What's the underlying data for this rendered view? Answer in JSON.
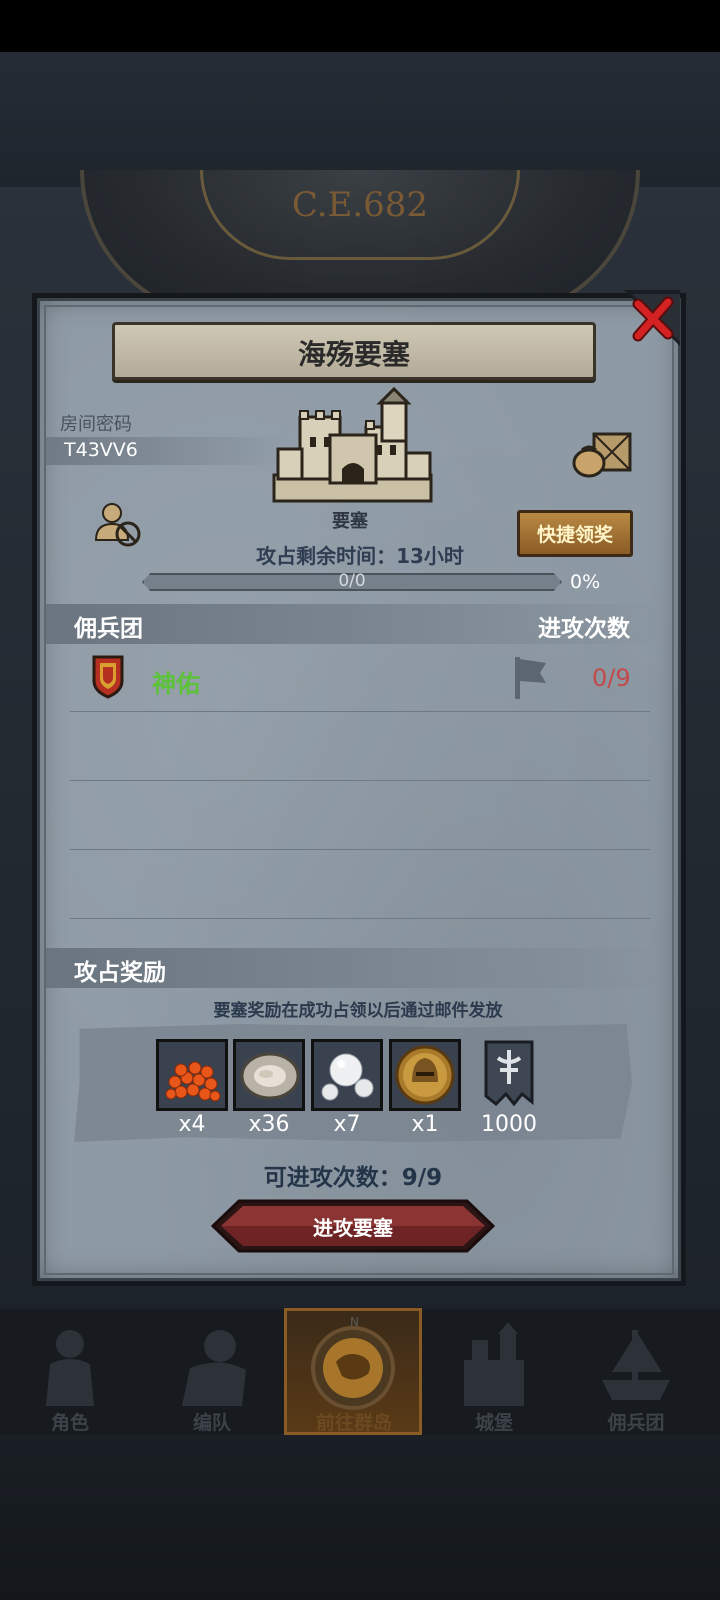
{
  "background": {
    "year_label": "C.E.682"
  },
  "dialog": {
    "title": "海殇要塞",
    "room_code_label": "房间密码",
    "room_code_value": "T43VV6",
    "castle_label": "要塞",
    "time_remaining": "攻占剩余时间：13小时",
    "quick_claim_label": "快捷领奖",
    "progress": {
      "text": "0/0",
      "percent_label": "0%",
      "fraction": 0
    },
    "mercenary_section": {
      "title": "佣兵团",
      "attacks_header": "进攻次数",
      "rows": [
        {
          "name": "神佑",
          "count": "0/9"
        }
      ]
    },
    "reward_section": {
      "title": "攻占奖励",
      "note": "要塞奖励在成功占领以后通过邮件发放",
      "items": [
        {
          "icon": "fish-roe-icon",
          "qty": "x4"
        },
        {
          "icon": "oyster-icon",
          "qty": "x36"
        },
        {
          "icon": "pearl-icon",
          "qty": "x7"
        },
        {
          "icon": "knight-helmet-coin-icon",
          "qty": "x1"
        },
        {
          "icon": "guild-banner-icon",
          "qty": "1000"
        }
      ]
    },
    "attacks_left": "可进攻次数：9/9",
    "attack_button_label": "进攻要塞"
  },
  "nav": {
    "items": [
      {
        "label": "角色",
        "icon": "knight-icon"
      },
      {
        "label": "编队",
        "icon": "team-icon"
      },
      {
        "label": "前往群岛",
        "icon": "compass-map-icon",
        "active": true
      },
      {
        "label": "城堡",
        "icon": "castle-icon"
      },
      {
        "label": "佣兵团",
        "icon": "ship-icon"
      }
    ]
  },
  "colors": {
    "panel": "#8e9aa5",
    "accent_green": "#5cc23a",
    "accent_red": "#c24a4a",
    "active_nav": "#8a5b22"
  }
}
